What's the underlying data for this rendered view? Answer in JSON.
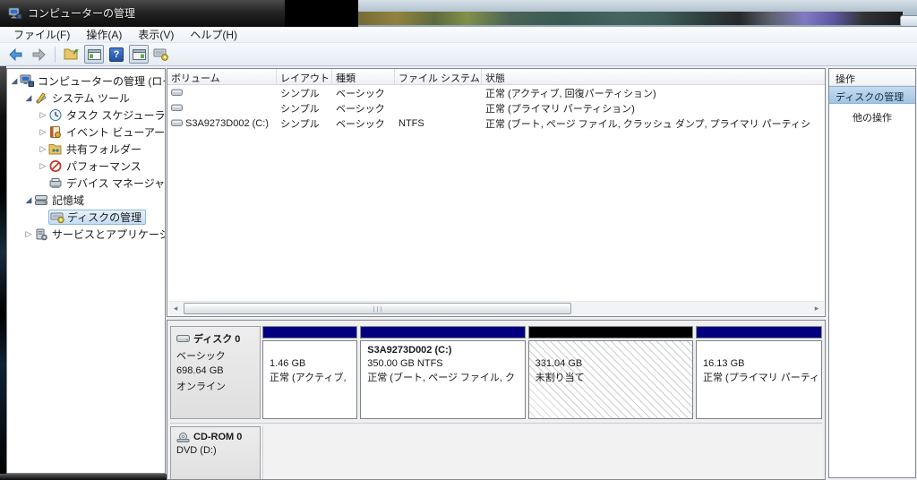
{
  "window": {
    "title": "コンピューターの管理"
  },
  "menu": {
    "items": [
      "ファイル(F)",
      "操作(A)",
      "表示(V)",
      "ヘルプ(H)"
    ]
  },
  "toolbar": {
    "help_glyph": "?",
    "icons": [
      "back-icon",
      "forward-icon",
      "export-list-icon",
      "show-console-tree-icon",
      "help-icon",
      "show-action-pane-icon",
      "disk-snapin-icon"
    ]
  },
  "scrollbar": {
    "left_glyph": "◂",
    "right_glyph": "▸"
  },
  "tree": {
    "items": [
      {
        "label": "コンピューターの管理 (ローカ",
        "expander": "◢",
        "icon": "computer-icon"
      },
      {
        "label": "システム ツール",
        "expander": "◢",
        "icon": "system-tools-icon"
      },
      {
        "label": "タスク スケジューラ",
        "expander": "▷",
        "icon": "task-scheduler-icon"
      },
      {
        "label": "イベント ビューアー",
        "expander": "▷",
        "icon": "event-viewer-icon"
      },
      {
        "label": "共有フォルダー",
        "expander": "▷",
        "icon": "shared-folders-icon"
      },
      {
        "label": "パフォーマンス",
        "expander": "▷",
        "icon": "performance-icon"
      },
      {
        "label": "デバイス マネージャー",
        "expander": "",
        "icon": "device-manager-icon"
      },
      {
        "label": "記憶域",
        "expander": "◢",
        "icon": "storage-icon"
      },
      {
        "label": "ディスクの管理",
        "expander": "",
        "icon": "disk-management-icon",
        "selected": true
      },
      {
        "label": "サービスとアプリケーショ",
        "expander": "▷",
        "icon": "services-icon"
      }
    ]
  },
  "volume_table": {
    "columns": [
      "ボリューム",
      "レイアウト",
      "種類",
      "ファイル システム",
      "状態"
    ],
    "rows": [
      {
        "volume": "",
        "layout": "シンプル",
        "type": "ベーシック",
        "fs": "",
        "status": "正常 (アクティブ, 回復パーティション)"
      },
      {
        "volume": "",
        "layout": "シンプル",
        "type": "ベーシック",
        "fs": "",
        "status": "正常 (プライマリ パーティション)"
      },
      {
        "volume": "S3A9273D002 (C:)",
        "layout": "シンプル",
        "type": "ベーシック",
        "fs": "NTFS",
        "status": "正常 (ブート, ページ ファイル, クラッシュ ダンプ, プライマリ パーティシ"
      }
    ]
  },
  "disks": {
    "disk0": {
      "name": "ディスク 0",
      "type": "ベーシック",
      "size": "698.64 GB",
      "status": "オンライン",
      "partitions": [
        {
          "title": "",
          "size_line": "1.46 GB",
          "status_line": "正常 (アクティブ,"
        },
        {
          "title": "S3A9273D002  (C:)",
          "size_line": "350.00 GB NTFS",
          "status_line": "正常 (ブート, ページ ファイル, ク"
        },
        {
          "title": "",
          "size_line": "331.04 GB",
          "status_line": "未割り当て"
        },
        {
          "title": "",
          "size_line": "16.13 GB",
          "status_line": "正常 (プライマリ パーティ"
        }
      ]
    },
    "cdrom": {
      "name": "CD-ROM 0",
      "media": "DVD (D:)"
    }
  },
  "actions": {
    "header": "操作",
    "disk_management": "ディスクの管理",
    "more": "他の操作"
  }
}
